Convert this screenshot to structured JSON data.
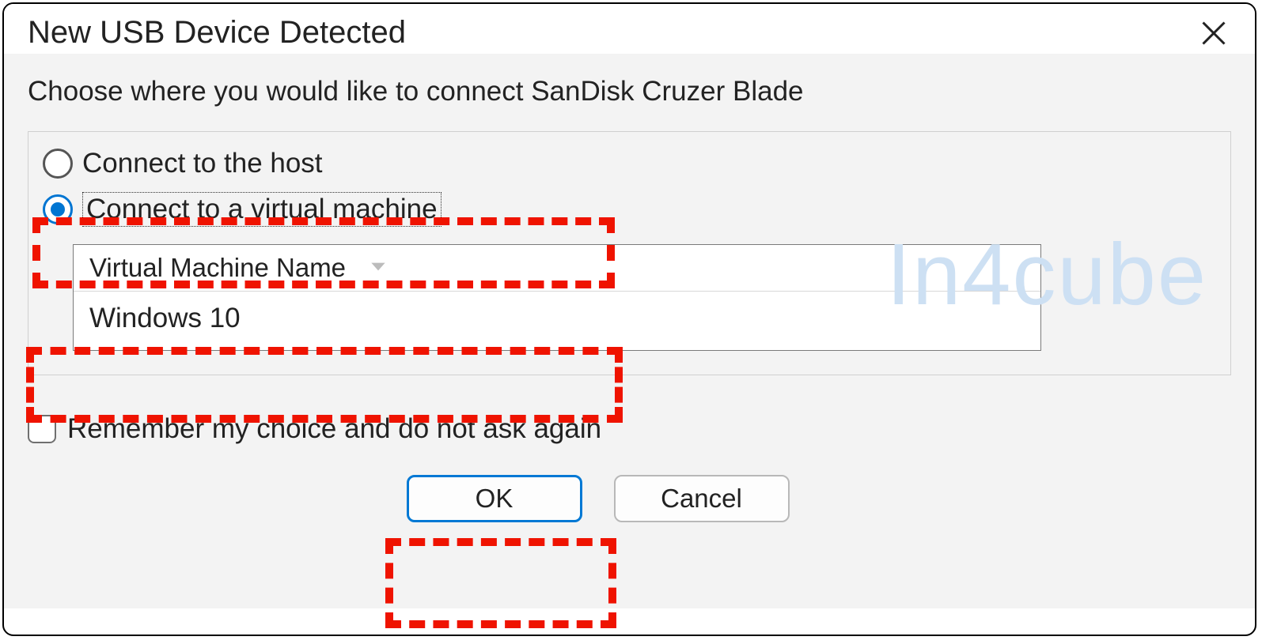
{
  "dialog": {
    "title": "New USB Device Detected",
    "instruction": "Choose where you would like to connect SanDisk Cruzer Blade",
    "radio_host": "Connect to the host",
    "radio_vm": "Connect to a virtual machine",
    "vm_header": "Virtual Machine Name",
    "vm_item": "Windows 10",
    "checkbox_label": "Remember my choice and do not ask again",
    "ok_label": "OK",
    "cancel_label": "Cancel"
  },
  "watermark": "In4cube"
}
